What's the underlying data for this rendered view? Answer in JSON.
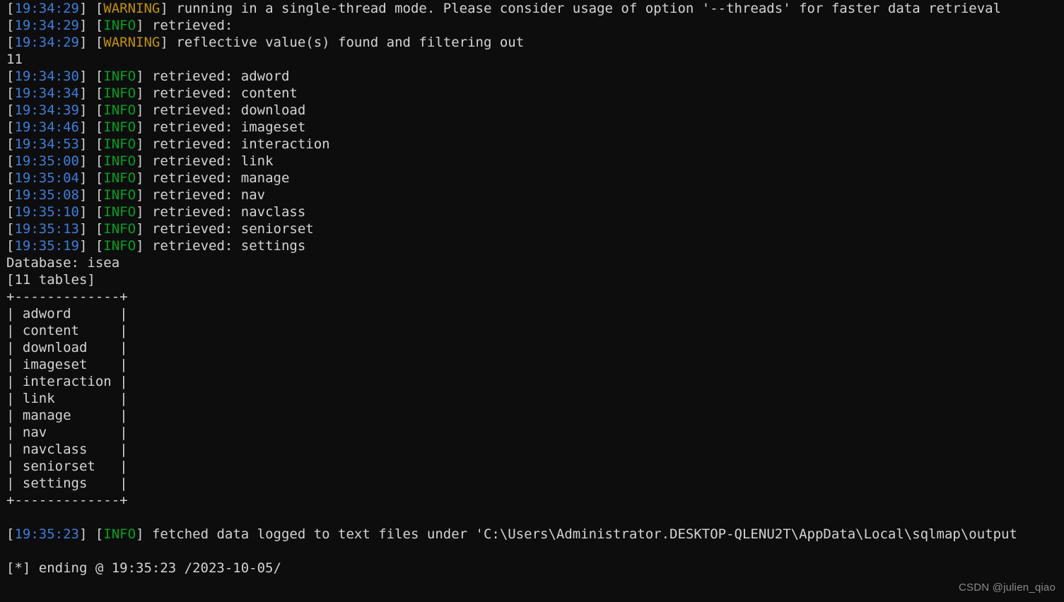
{
  "terminal": {
    "background_color": "#0d0d0d",
    "text_color": "#d4d4d4",
    "timestamp_color": "#3b7dd8",
    "info_color": "#00a11e",
    "warning_color": "#c29200",
    "lines": [
      {
        "type": "log",
        "timestamp": "19:34:29",
        "level": "WARNING",
        "message": "running in a single-thread mode. Please consider usage of option '--threads' for faster data retrieval"
      },
      {
        "type": "log",
        "timestamp": "19:34:29",
        "level": "INFO",
        "message": "retrieved:"
      },
      {
        "type": "log",
        "timestamp": "19:34:29",
        "level": "WARNING",
        "message": "reflective value(s) found and filtering out"
      },
      {
        "type": "plain",
        "text": "11"
      },
      {
        "type": "log",
        "timestamp": "19:34:30",
        "level": "INFO",
        "message": "retrieved: adword"
      },
      {
        "type": "log",
        "timestamp": "19:34:34",
        "level": "INFO",
        "message": "retrieved: content"
      },
      {
        "type": "log",
        "timestamp": "19:34:39",
        "level": "INFO",
        "message": "retrieved: download"
      },
      {
        "type": "log",
        "timestamp": "19:34:46",
        "level": "INFO",
        "message": "retrieved: imageset"
      },
      {
        "type": "log",
        "timestamp": "19:34:53",
        "level": "INFO",
        "message": "retrieved: interaction"
      },
      {
        "type": "log",
        "timestamp": "19:35:00",
        "level": "INFO",
        "message": "retrieved: link"
      },
      {
        "type": "log",
        "timestamp": "19:35:04",
        "level": "INFO",
        "message": "retrieved: manage"
      },
      {
        "type": "log",
        "timestamp": "19:35:08",
        "level": "INFO",
        "message": "retrieved: nav"
      },
      {
        "type": "log",
        "timestamp": "19:35:10",
        "level": "INFO",
        "message": "retrieved: navclass"
      },
      {
        "type": "log",
        "timestamp": "19:35:13",
        "level": "INFO",
        "message": "retrieved: seniorset"
      },
      {
        "type": "log",
        "timestamp": "19:35:19",
        "level": "INFO",
        "message": "retrieved: settings"
      },
      {
        "type": "plain",
        "text": "Database: isea"
      },
      {
        "type": "plain",
        "text": "[11 tables]"
      },
      {
        "type": "plain",
        "text": "+-------------+"
      },
      {
        "type": "plain",
        "text": "| adword      |"
      },
      {
        "type": "plain",
        "text": "| content     |"
      },
      {
        "type": "plain",
        "text": "| download    |"
      },
      {
        "type": "plain",
        "text": "| imageset    |"
      },
      {
        "type": "plain",
        "text": "| interaction |"
      },
      {
        "type": "plain",
        "text": "| link        |"
      },
      {
        "type": "plain",
        "text": "| manage      |"
      },
      {
        "type": "plain",
        "text": "| nav         |"
      },
      {
        "type": "plain",
        "text": "| navclass    |"
      },
      {
        "type": "plain",
        "text": "| seniorset   |"
      },
      {
        "type": "plain",
        "text": "| settings    |"
      },
      {
        "type": "plain",
        "text": "+-------------+"
      },
      {
        "type": "blank",
        "text": ""
      },
      {
        "type": "log",
        "timestamp": "19:35:23",
        "level": "INFO",
        "message": "fetched data logged to text files under 'C:\\Users\\Administrator.DESKTOP-QLENU2T\\AppData\\Local\\sqlmap\\output"
      },
      {
        "type": "blank",
        "text": ""
      },
      {
        "type": "plain",
        "text": "[*] ending @ 19:35:23 /2023-10-05/"
      }
    ],
    "database": {
      "name": "isea",
      "table_count_label": "[11 tables]",
      "table_count": 11,
      "tables": [
        "adword",
        "content",
        "download",
        "imageset",
        "interaction",
        "link",
        "manage",
        "nav",
        "navclass",
        "seniorset",
        "settings"
      ]
    }
  },
  "watermark": {
    "text": "CSDN @julien_qiao"
  }
}
